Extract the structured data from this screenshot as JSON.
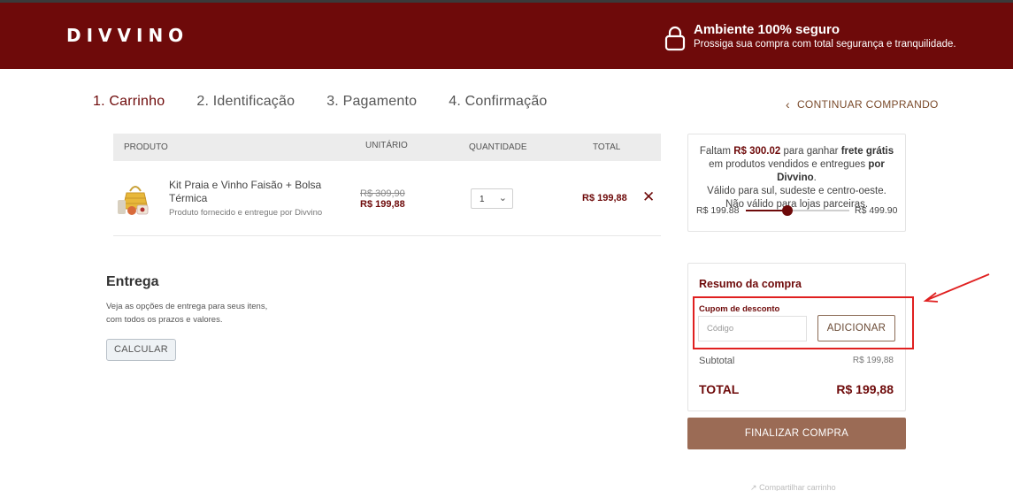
{
  "header": {
    "logo_text": "DIVVINO",
    "secure_title": "Ambiente 100% seguro",
    "secure_subtitle": "Prossiga sua compra com total segurança e tranquilidade.",
    "icon": "lock-icon"
  },
  "steps": [
    {
      "label": "1. Carrinho",
      "active": true
    },
    {
      "label": "2. Identificação",
      "active": false
    },
    {
      "label": "3. Pagamento",
      "active": false
    },
    {
      "label": "4. Confirmação",
      "active": false
    }
  ],
  "continue_shopping": "CONTINUAR COMPRANDO",
  "cart_table": {
    "headers": {
      "product": "PRODUTO",
      "unit": "UNITÁRIO",
      "quantity": "QUANTIDADE",
      "total": "TOTAL"
    },
    "items": [
      {
        "name": "Kit Praia e Vinho Faisão + Bolsa Térmica",
        "seller": "Produto fornecido e entregue por Divvino",
        "price_old": "R$ 309,90",
        "price_new": "R$ 199,88",
        "quantity": "1",
        "total": "R$ 199,88"
      }
    ]
  },
  "entrega": {
    "title": "Entrega",
    "description_line1": "Veja as opções de entrega para seus itens,",
    "description_line2": "com todos os prazos e valores.",
    "button": "CALCULAR"
  },
  "frete": {
    "text_pre": "Faltam ",
    "amount": "R$ 300.02",
    "text_mid": " para ganhar ",
    "highlight": "frete grátis",
    "text_mid2": " em produtos vendidos e entregues ",
    "by": "por Divvino",
    "text_end": ".",
    "line_valid": "Válido para sul, sudeste e centro-oeste.",
    "line_invalid": "Não válido para lojas parceiras.",
    "range_min": "R$ 199.88",
    "range_max": "R$ 499.90",
    "progress_value": 199.88,
    "progress_min": 0,
    "progress_max": 499.9
  },
  "resumo": {
    "title": "Resumo da compra",
    "coupon_label": "Cupom de desconto",
    "coupon_placeholder": "Código",
    "coupon_button": "ADICIONAR",
    "subtotal_label": "Subtotal",
    "subtotal_value": "R$ 199,88",
    "total_label": "TOTAL",
    "total_value": "R$ 199,88"
  },
  "finalize_button": "FINALIZAR COMPRA",
  "share_text": "Compartilhar carrinho",
  "colors": {
    "brand": "#6e0a0a",
    "finalize": "#9b6b55",
    "annotation": "#e02020"
  }
}
